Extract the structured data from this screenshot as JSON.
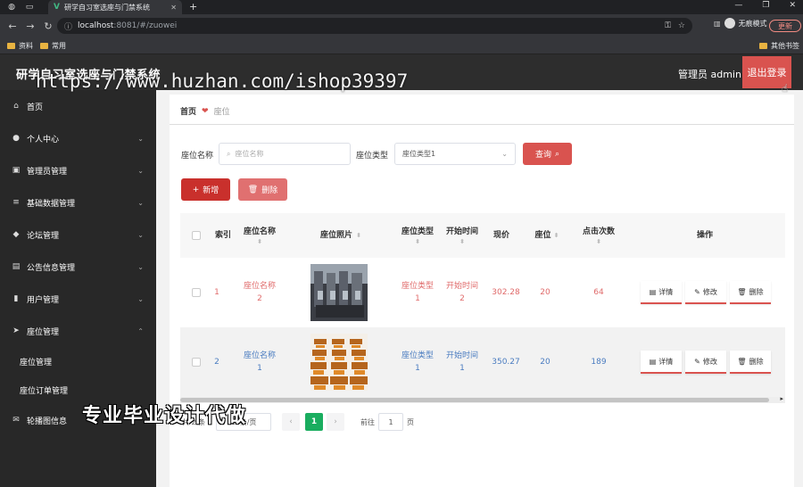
{
  "browser": {
    "tab_title": "研学自习室选座与门禁系统",
    "url_host": "localhost",
    "url_path": ":8081/#/zuowei",
    "profile_label": "无痕模式",
    "update_label": "更新",
    "bookmarks": [
      "资料",
      "常用"
    ],
    "bookmarks_right": "其他书签"
  },
  "header": {
    "title": "研学自习室选座与门禁系统",
    "watermark": "https://www.huzhan.com/ishop39397",
    "user": "管理员 admin",
    "logout": "退出登录"
  },
  "sidebar": {
    "items": [
      {
        "label": "首页",
        "icon": "home-icon"
      },
      {
        "label": "个人中心",
        "icon": "person-icon"
      },
      {
        "label": "管理员管理",
        "icon": "admin-icon"
      },
      {
        "label": "基础数据管理",
        "icon": "list-icon"
      },
      {
        "label": "论坛管理",
        "icon": "forum-icon"
      },
      {
        "label": "公告信息管理",
        "icon": "notice-icon"
      },
      {
        "label": "用户管理",
        "icon": "chart-icon"
      },
      {
        "label": "座位管理",
        "icon": "send-icon"
      },
      {
        "label": "轮播图信息",
        "icon": "mail-icon"
      }
    ],
    "sub_items": [
      "座位管理",
      "座位订单管理"
    ]
  },
  "breadcrumb": {
    "home": "首页",
    "current": "座位"
  },
  "filters": {
    "name_label": "座位名称",
    "name_placeholder": "座位名称",
    "type_label": "座位类型",
    "type_value": "座位类型1",
    "search_label": "查询"
  },
  "actions": {
    "add_label": "新增",
    "delete_label": "删除"
  },
  "table": {
    "headers": {
      "index": "索引",
      "name": "座位名称",
      "photo": "座位照片",
      "type": "座位类型",
      "start": "开始时间",
      "price": "现价",
      "seat": "座位",
      "clicks": "点击次数",
      "ops": "操作"
    },
    "rows": [
      {
        "index": "1",
        "name_a": "座位名称",
        "name_b": "2",
        "photo": "seats-photo",
        "type_a": "座位类型",
        "type_b": "1",
        "start_a": "开始时间",
        "start_b": "2",
        "price": "302.28",
        "seat": "20",
        "clicks": "64"
      },
      {
        "index": "2",
        "name_a": "座位名称",
        "name_b": "1",
        "photo": "desks-photo",
        "type_a": "座位类型",
        "type_b": "1",
        "start_a": "开始时间",
        "start_b": "1",
        "price": "350.27",
        "seat": "20",
        "clicks": "189"
      }
    ],
    "op_labels": {
      "detail": "详情",
      "edit": "修改",
      "delete": "删除"
    }
  },
  "pagination": {
    "total_partial": "共 2 条",
    "size_partial": "10条/页",
    "current_page": "1",
    "goto_label": "前往",
    "goto_value": "1",
    "page_suffix": "页"
  },
  "overlay": "专业毕业设计代做",
  "colors": {
    "accent": "#d9534f",
    "sidebar": "#282828",
    "header": "#2d2d2d",
    "pager_active": "#1aad5f",
    "link_blue": "#4a7cc0"
  }
}
